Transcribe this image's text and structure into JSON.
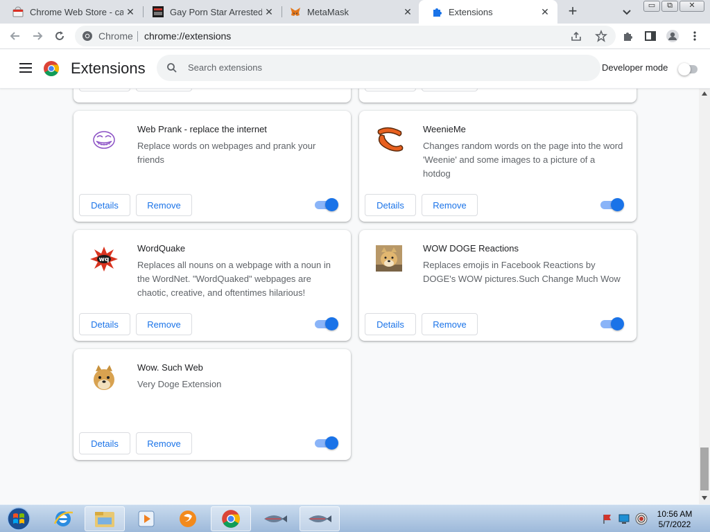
{
  "tabs": [
    {
      "title": "Chrome Web Store - cat",
      "active": false
    },
    {
      "title": "Gay Porn Star Arrested Fo",
      "active": false
    },
    {
      "title": "MetaMask",
      "active": false
    },
    {
      "title": "Extensions",
      "active": true
    }
  ],
  "tab_close_glyph": "✕",
  "new_tab_glyph": "+",
  "window_controls": {
    "minimize": "▭",
    "restore": "⧉",
    "close": "✕"
  },
  "omnibox": {
    "site": "Chrome",
    "url": "chrome://extensions"
  },
  "header": {
    "title": "Extensions",
    "search_placeholder": "Search extensions",
    "developer_mode_label": "Developer mode",
    "developer_mode_on": false
  },
  "buttons": {
    "details": "Details",
    "remove": "Remove"
  },
  "extensions": [
    {
      "name": "Web Prank - replace the internet",
      "description": "Replace words on webpages and prank your friends",
      "icon": "troll-face-icon",
      "enabled": true
    },
    {
      "name": "WeenieMe",
      "description": "Changes random words on the page into the word 'Weenie' and some images to a picture of a hotdog",
      "icon": "hotdog-icon",
      "enabled": true
    },
    {
      "name": "WordQuake",
      "description": "Replaces all nouns on a webpage with a noun in the WordNet. \"WordQuaked\" webpages are chaotic, creative, and oftentimes hilarious!",
      "icon": "wordquake-icon",
      "enabled": true
    },
    {
      "name": "WOW DOGE Reactions",
      "description": "Replaces emojis in Facebook Reactions by DOGE's WOW pictures.Such Change Much Wow",
      "icon": "doge-photo-icon",
      "enabled": true
    },
    {
      "name": "Wow. Such Web",
      "description": "Very Doge Extension",
      "icon": "doge-icon",
      "enabled": true
    }
  ],
  "taskbar": {
    "time": "10:56 AM",
    "date": "5/7/2022"
  },
  "colors": {
    "accent": "#1a73e8",
    "toggle_track": "#8ab4f8",
    "tabstrip": "#dee1e6"
  }
}
